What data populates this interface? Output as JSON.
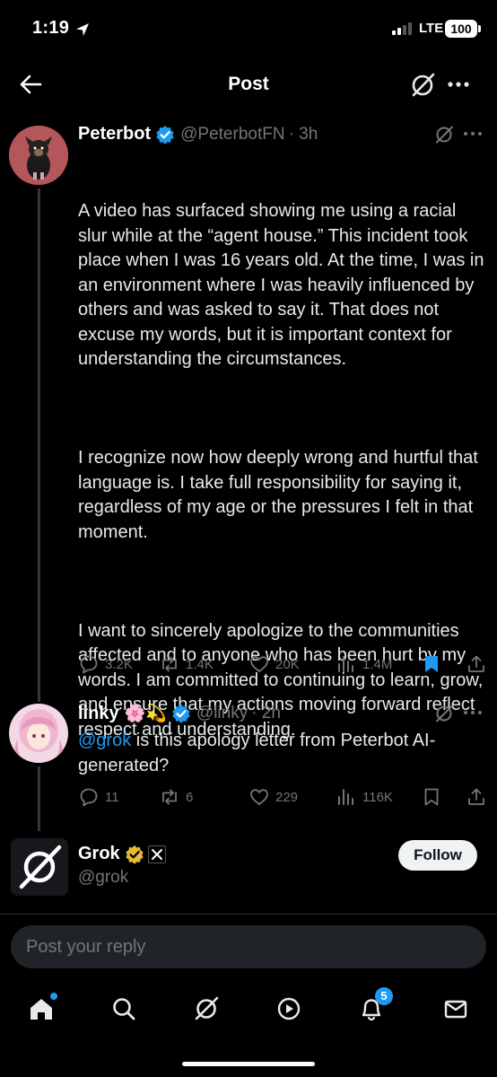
{
  "status_bar": {
    "time": "1:19",
    "network": "LTE",
    "battery": "100"
  },
  "header": {
    "title": "Post"
  },
  "posts": [
    {
      "name": "Peterbot",
      "handle": "@PeterbotFN",
      "time": "· 3h",
      "paragraphs": [
        "A video has surfaced showing me using a racial slur while at the “agent house.” This incident took place when I was 16 years old. At the time, I was in an environment where I was heavily influenced by others and was asked to say it. That does not excuse my words, but it is important context for understanding the circumstances.",
        "I recognize now how deeply wrong and hurtful that language is. I take full responsibility for saying it, regardless of my age or the pressures I felt in that moment.",
        "I want to sincerely apologize to the communities affected and to anyone who has been hurt by my words. I am committed to continuing to learn, grow, and ensure that my actions moving forward reflect respect and understanding."
      ],
      "stats": {
        "replies": "3.2K",
        "reposts": "1.4K",
        "likes": "20K",
        "views": "1.4M"
      }
    },
    {
      "name": "linky",
      "emojis": "🌸💫",
      "handle": "@linky",
      "time": "· 2h",
      "mention": "@grok",
      "text": " is this apology letter from Peterbot AI-generated?",
      "stats": {
        "replies": "11",
        "reposts": "6",
        "likes": "229",
        "views": "116K"
      }
    },
    {
      "name": "Grok",
      "handle": "@grok",
      "follow_label": "Follow"
    }
  ],
  "reply": {
    "placeholder": "Post your reply"
  },
  "tabbar": {
    "notifications_badge": "5"
  },
  "colors": {
    "accent": "#1d9bf0",
    "muted": "#71767b",
    "gold": "#e9b931",
    "background": "#000000"
  }
}
